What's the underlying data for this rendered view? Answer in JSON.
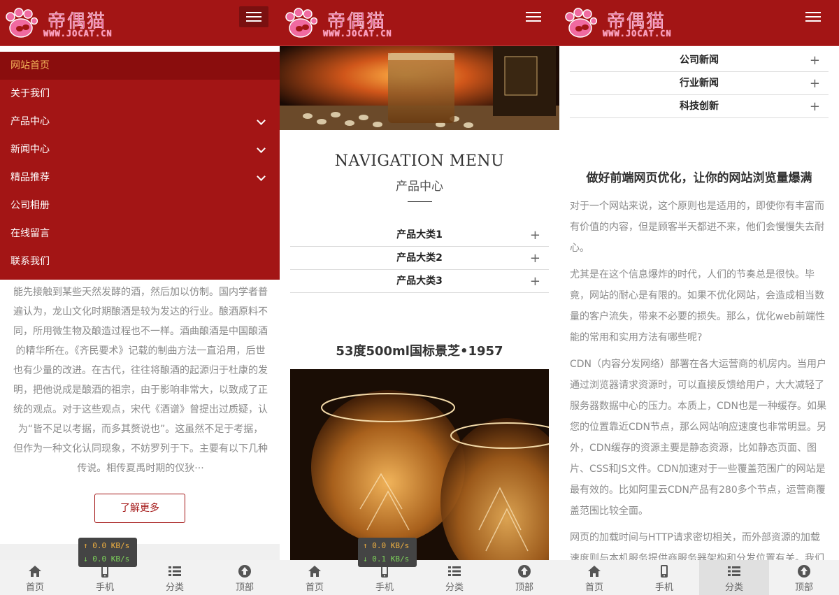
{
  "logo": {
    "cn": "帝偶猫",
    "url": "WWW.JOCAT.CN"
  },
  "panel1": {
    "menu": [
      {
        "label": "网站首页",
        "active": true,
        "has_chevron": false
      },
      {
        "label": "关于我们",
        "active": false,
        "has_chevron": false
      },
      {
        "label": "产品中心",
        "active": false,
        "has_chevron": true
      },
      {
        "label": "新闻中心",
        "active": false,
        "has_chevron": true
      },
      {
        "label": "精品推荐",
        "active": false,
        "has_chevron": true
      },
      {
        "label": "公司相册",
        "active": false,
        "has_chevron": false
      },
      {
        "label": "在线留言",
        "active": false,
        "has_chevron": false
      },
      {
        "label": "联系我们",
        "active": false,
        "has_chevron": false
      }
    ],
    "text_lines": [
      "能先接触到某些天然发酵的酒，然后加以仿制。国内学者普",
      "遍认为，龙山文化时期酿酒是较为发达的行业。酿酒原料不",
      "同，所用微生物及酿造过程也不一样。酒曲酿酒是中国酿酒",
      "的精华所在。《齐民要术》记载的制曲方法一直沿用，后世",
      "也有少量的改进。在古代，往往将酿酒的起源归于杜康的发",
      "明，把他说成是酿酒的祖宗，由于影响非常大，以致成了正",
      "统的观点。对于这些观点，宋代《酒谱》曾提出过质疑，认",
      "为“皆不足以考据，而多其赘说也”。这虽然不足于考据，",
      "但作为一种文化认同现象，不妨罗列于下。主要有以下几种",
      "传说。相传夏禹时期的仪狄···"
    ],
    "more_button": "了解更多",
    "speed": {
      "up": "↑ 0.0 KB/s",
      "down": "↓ 0.0 KB/s"
    }
  },
  "panel2": {
    "nav_title": "NAVIGATION MENU",
    "nav_subtitle": "产品中心",
    "categories": [
      "产品大类1",
      "产品大类2",
      "产品大类3"
    ],
    "product_title": "53度500ml国标景芝•1957",
    "speed": {
      "up": "↑ 0.0 KB/s",
      "down": "↓ 0.1 KB/s"
    },
    "slider_active_index": 0
  },
  "panel3": {
    "categories": [
      "公司新闻",
      "行业新闻",
      "科技创新"
    ],
    "article_title": "做好前端网页优化，让你的网站浏览量爆满",
    "paragraphs": [
      "对于一个网站来说，这个原则也是适用的，即使你有丰富而有价值的内容，但是顾客半天都进不来，他们会慢慢失去耐心。",
      "尤其是在这个信息爆炸的时代，人们的节奏总是很快。毕竟，网站的耐心是有限的。如果不优化网站，会造成相当数量的客户流失，带来不必要的损失。那么，优化web前端性能的常用和实用方法有哪些呢?",
      "CDN（内容分发网络）部署在各大运营商的机房内。当用户通过浏览器请求资源时，可以直接反馈给用户，大大减轻了服务器数据中心的压力。本质上，CDN也是一种缓存。如果您的位置靠近CDN节点，那么网站响应速度也非常明显。另外，CDN缓存的资源主要是静态资源，比如静态页面、图片、CSS和JS文件。CDN加速对于一些覆盖范围广的网站是最有效的。比如阿里云CDN产品有280多个节点，运营商覆盖范围比较全面。",
      "网页的加载时间与HTTP请求密切相关，而外部资源的加载速度则与本机服务提供商服务器架构和分发位置有关。我们"
    ]
  },
  "footer": [
    {
      "label": "首页",
      "icon": "home-icon"
    },
    {
      "label": "手机",
      "icon": "mobile-icon"
    },
    {
      "label": "分类",
      "icon": "list-icon"
    },
    {
      "label": "顶部",
      "icon": "up-arrow-icon"
    }
  ],
  "colors": {
    "brand": "#a31515",
    "active_menu_text": "#f3b35a"
  }
}
